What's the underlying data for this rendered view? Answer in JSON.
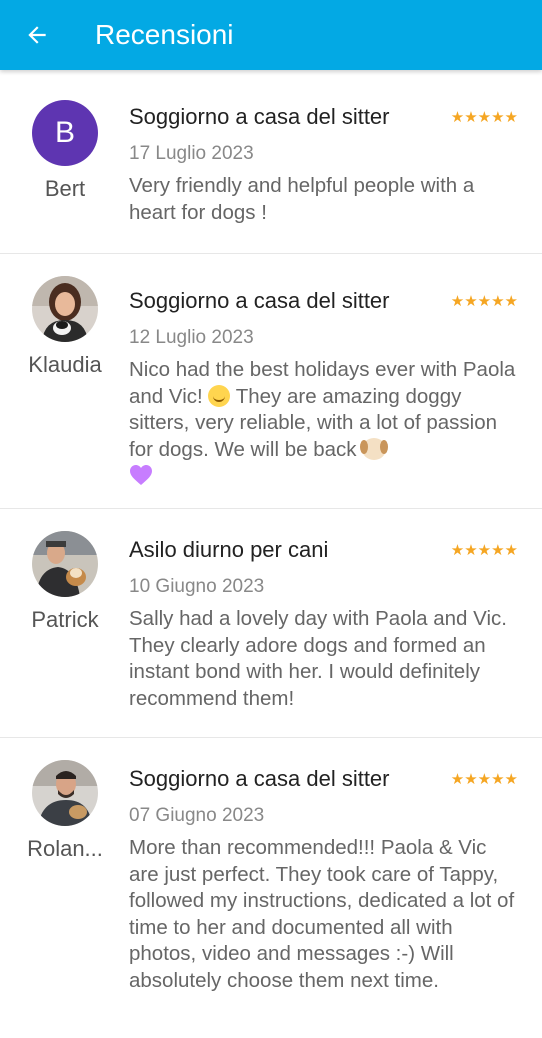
{
  "header": {
    "title": "Recensioni",
    "back_icon": "arrow-left-icon"
  },
  "colors": {
    "appbar": "#03A9E4",
    "star": "#F5A623",
    "avatar_letter_bg": "#5E35B1"
  },
  "reviews": [
    {
      "reviewer": "Bert",
      "avatar_letter": "B",
      "service": "Soggiorno a casa del sitter",
      "rating": 5,
      "stars": "★★★★★",
      "date": "17 Luglio 2023",
      "text": "Very friendly and helpful people with a heart for dogs !"
    },
    {
      "reviewer": "Klaudia",
      "service": "Soggiorno a casa del sitter",
      "rating": 5,
      "stars": "★★★★★",
      "date": "12 Luglio 2023",
      "text_part1": "Nico had the best holidays ever with Paola and Vic! ",
      "text_part2": " They are amazing doggy sitters, very reliable, with a lot of passion for dogs. We will be back "
    },
    {
      "reviewer": "Patrick",
      "service": "Asilo diurno per cani",
      "rating": 5,
      "stars": "★★★★★",
      "date": "10 Giugno 2023",
      "text": "Sally had a lovely day with Paola and Vic. They clearly adore dogs and formed an instant bond with her. I would definitely recommend them!"
    },
    {
      "reviewer": "Rolan...",
      "service": "Soggiorno a casa del sitter",
      "rating": 5,
      "stars": "★★★★★",
      "date": "07 Giugno 2023",
      "text": "More than recommended!!! Paola & Vic are just perfect. They took care of Tappy, followed my instructions, dedicated a lot of time to her and documented all with photos, video and messages :-) Will absolutely choose them next time."
    }
  ]
}
